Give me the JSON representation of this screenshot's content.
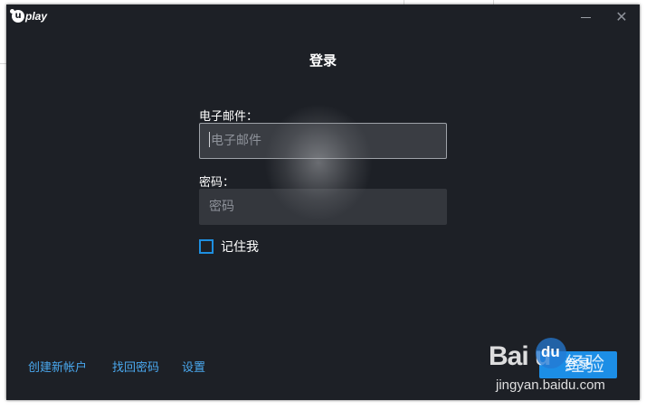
{
  "window": {
    "logo_text": "play",
    "logo_letter": "u",
    "minimize_icon": "minimize-icon",
    "close_icon": "close-icon",
    "close_glyph": "✕"
  },
  "login": {
    "title": "登录",
    "email_label": "电子邮件：",
    "email_placeholder": "电子邮件",
    "password_label": "密码：",
    "password_placeholder": "密码",
    "remember_label": "记住我",
    "login_button": "登录"
  },
  "footer": {
    "create_account": "创建新帐户",
    "recover_password": "找回密码",
    "settings": "设置"
  },
  "watermark": {
    "brand": "Bai  u",
    "paw_text": "du",
    "cn": "经验",
    "url": "jingyan.baidu.com"
  },
  "colors": {
    "window_bg": "#1d2026",
    "field_bg": "#34373d",
    "accent": "#1c8ee6",
    "link": "#4aa8ee"
  }
}
